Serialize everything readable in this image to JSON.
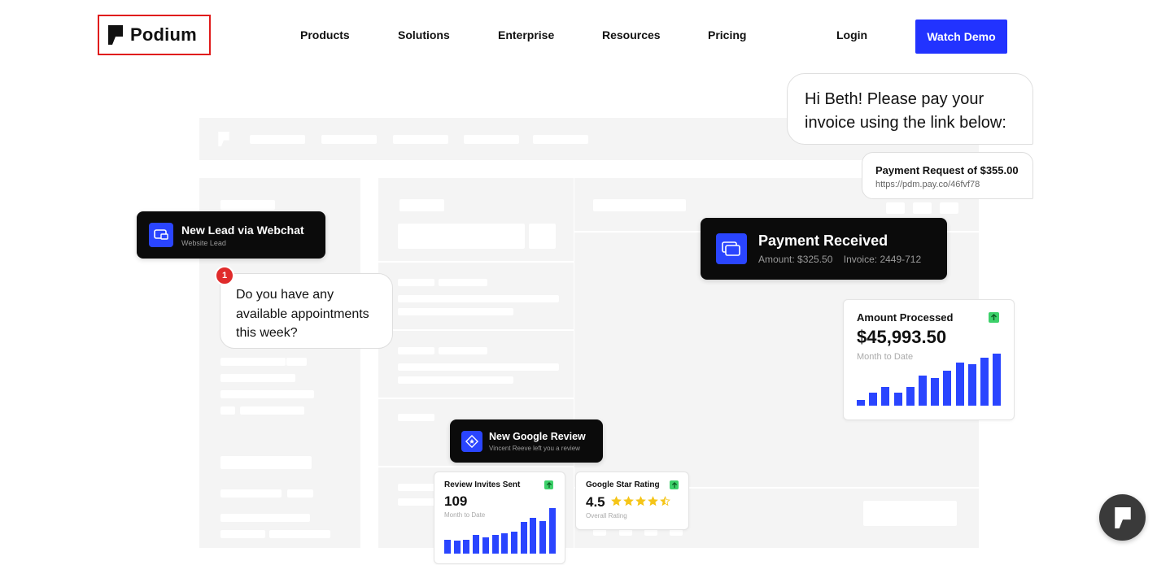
{
  "nav": {
    "logo_text": "Podium",
    "items": [
      "Products",
      "Solutions",
      "Enterprise",
      "Resources",
      "Pricing"
    ],
    "login": "Login",
    "cta": "Watch Demo"
  },
  "invoice_message": {
    "line1": "Hi Beth! Please pay your",
    "line2": "invoice using the link below:"
  },
  "payment_request": {
    "title": "Payment Request of $355.00",
    "link": "https://pdm.pay.co/46fvf78"
  },
  "new_lead": {
    "title": "New Lead via Webchat",
    "subtitle": "Website Lead"
  },
  "notification_count": "1",
  "appointment_message": {
    "line1": "Do you have any",
    "line2": "available appointments",
    "line3": "this week?"
  },
  "payment_received": {
    "title": "Payment Received",
    "amount": "Amount: $325.50",
    "invoice": "Invoice: 2449-712"
  },
  "amount_processed": {
    "title": "Amount Processed",
    "value": "$45,993.50",
    "period": "Month to Date",
    "bars": [
      0.09,
      0.2,
      0.3,
      0.2,
      0.3,
      0.47,
      0.43,
      0.55,
      0.68,
      0.66,
      0.76,
      0.82
    ]
  },
  "google_review": {
    "title": "New Google Review",
    "subtitle": "Vincent Reeve left you a review"
  },
  "review_invites": {
    "title": "Review Invites Sent",
    "value": "109",
    "period": "Month to Date",
    "bars": [
      0.28,
      0.25,
      0.28,
      0.37,
      0.32,
      0.37,
      0.41,
      0.43,
      0.63,
      0.71,
      0.64,
      0.9
    ]
  },
  "star_rating": {
    "title": "Google Star Rating",
    "value": "4.5",
    "stars": 4.5,
    "caption": "Overall Rating"
  },
  "colors": {
    "accent": "#2233ff",
    "bar": "#2a45ff",
    "up_badge": "#3dd16a",
    "star": "#f5c518",
    "notification": "#e02b2b"
  },
  "icons": {
    "logo": "podium-logo-icon",
    "lead": "webchat-icon",
    "payment": "credit-card-icon",
    "review": "google-star-icon",
    "chat": "chat-widget-icon",
    "up": "arrow-up-icon"
  }
}
